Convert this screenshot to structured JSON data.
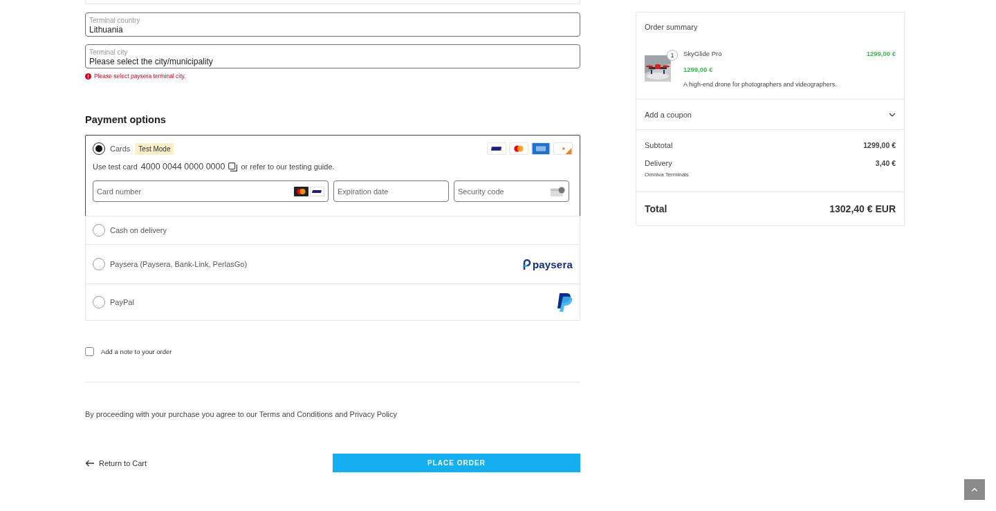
{
  "terminal_fields": [
    {
      "label": "Terminal country",
      "value": "Lithuania"
    },
    {
      "label": "Terminal city",
      "value": "Please select the city/municipality",
      "error": "Please select paysera terminal city."
    }
  ],
  "payment": {
    "heading": "Payment options",
    "methods": [
      {
        "kind": "cards",
        "label": "Cards",
        "selected": true,
        "badge": "Test Mode",
        "test_prefix": "Use test card",
        "test_number": "4000 0044 0000 0000",
        "test_suffix": "or refer to our testing guide.",
        "fields": [
          {
            "placeholder": "Card number",
            "kind": "number"
          },
          {
            "placeholder": "Expiration date",
            "kind": "expiry"
          },
          {
            "placeholder": "Security code",
            "kind": "cvc"
          }
        ]
      },
      {
        "kind": "plain",
        "label": "Cash on delivery",
        "selected": false
      },
      {
        "kind": "paysera",
        "label": "Paysera (Paysera, Bank-Link, PerlasGo)",
        "selected": false,
        "logo_text": "paysera"
      },
      {
        "kind": "paypal",
        "label": "PayPal",
        "selected": false
      }
    ]
  },
  "note": {
    "label": "Add a note to your order",
    "checked": false
  },
  "terms": {
    "before": "By proceeding with your purchase you agree to our",
    "terms_link": "Terms and Conditions",
    "middle": "and",
    "privacy_link": "Privacy Policy"
  },
  "return_link": "Return to Cart",
  "place_order": "PLACE ORDER",
  "summary": {
    "title": "Order summary",
    "item": {
      "kind": "picture",
      "quantity": "1",
      "name": "SkyGlide Pro",
      "price": "1299,00 €",
      "unit_price": "1299,00 €",
      "description": "A high-end drone for photographers and videographers."
    },
    "coupon": {
      "label": "Add a coupon",
      "expanded": false
    },
    "lines": [
      {
        "label": "Subtotal",
        "value": "1299,00 €"
      },
      {
        "label": "Delivery",
        "value": "3,40 €",
        "note": "Omniva Terminals"
      }
    ],
    "total": {
      "label": "Total",
      "value": "1302,40 € EUR"
    }
  }
}
